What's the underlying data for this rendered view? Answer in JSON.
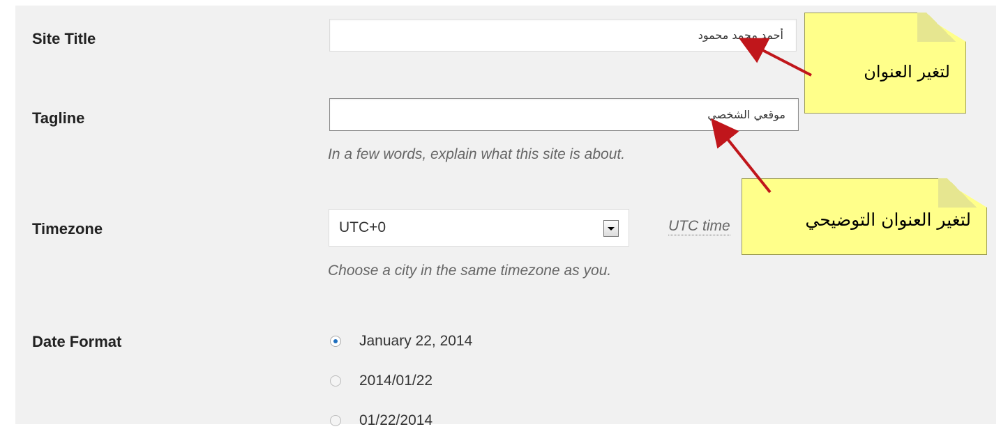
{
  "settings": {
    "site_title": {
      "label": "Site Title",
      "value": "أحمد محمد محمود"
    },
    "tagline": {
      "label": "Tagline",
      "value": "موقعي الشخصي",
      "description": "In a few words, explain what this site is about."
    },
    "timezone": {
      "label": "Timezone",
      "selected": "UTC+0",
      "utc_time_label": "UTC time",
      "description": "Choose a city in the same timezone as you."
    },
    "date_format": {
      "label": "Date Format",
      "options": [
        {
          "label": "January 22, 2014",
          "checked": true
        },
        {
          "label": "2014/01/22",
          "checked": false
        },
        {
          "label": "01/22/2014",
          "checked": false
        }
      ]
    }
  },
  "annotations": {
    "title_callout": "لتغير العنوان",
    "tagline_callout": "لتغير العنوان التوضيحي"
  },
  "colors": {
    "panel_bg": "#f1f1f1",
    "callout_bg": "#ffff8a",
    "arrow": "#c0161b",
    "radio_accent": "#1e6fbf"
  }
}
